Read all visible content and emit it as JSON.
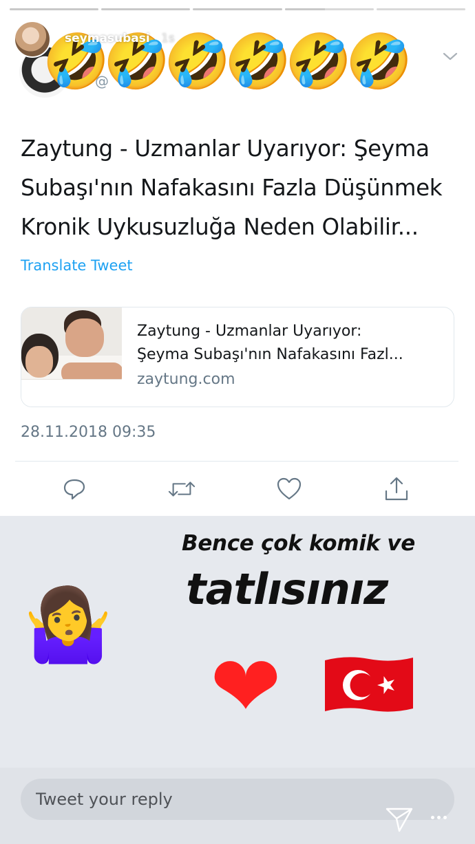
{
  "story": {
    "progress": [
      1.0,
      1.0,
      1.0,
      0.45,
      0.0
    ],
    "username": "seymasubasi",
    "time": "1s"
  },
  "emoji_overlay": {
    "laugh_emojis": [
      "🤣",
      "🤣",
      "🤣",
      "🤣",
      "🤣",
      "🤣"
    ]
  },
  "tweet": {
    "handle_partial": "@",
    "text_lines": [
      "Zaytung - Uzmanlar Uyarıyor: Şeyma",
      "Subaşı'nın Nafakasını Fazla Düşünmek",
      "Kronik Uykusuzluğa Neden Olabilir..."
    ],
    "translate_label": "Translate Tweet",
    "card": {
      "title_lines": [
        "Zaytung - Uzmanlar Uyarıyor:",
        "Şeyma Subaşı'nın Nafakasını Fazl..."
      ],
      "domain": "zaytung.com"
    },
    "timestamp": "28.11.2018 09:35",
    "actions": [
      "reply-icon",
      "retweet-icon",
      "like-icon",
      "share-icon"
    ]
  },
  "overlay": {
    "caption_line1": "Bence çok komik ve",
    "caption_line2": "tatlısınız",
    "shrug_emoji": "🤷‍♀️",
    "heart_emoji": "❤",
    "flag_colors": {
      "red": "#e30a17",
      "white": "#ffffff"
    }
  },
  "reply": {
    "placeholder": "Tweet your reply"
  },
  "colors": {
    "link_blue": "#1da1f2",
    "secondary_text": "#657786",
    "overlay_bg": "#e6e9ee"
  }
}
